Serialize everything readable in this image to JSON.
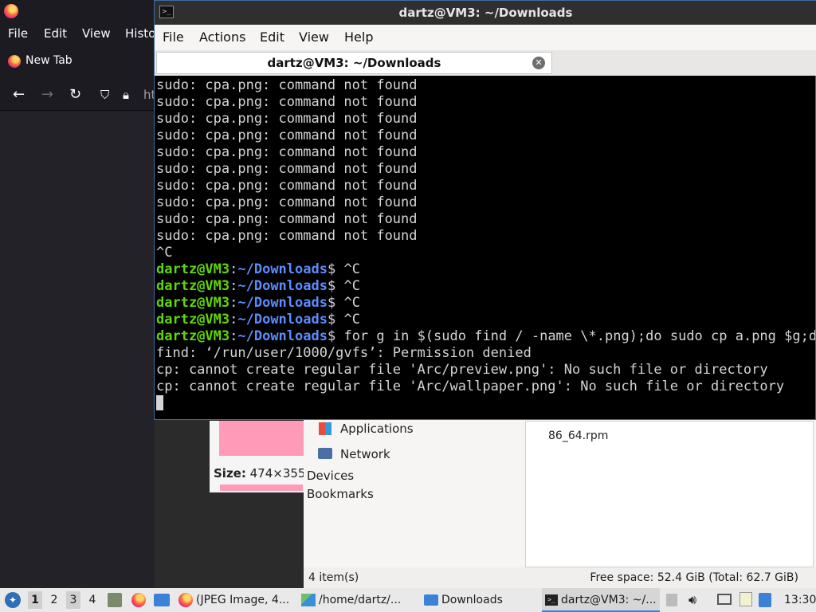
{
  "firefox": {
    "menu": [
      "File",
      "Edit",
      "View",
      "Histo"
    ],
    "tab_label": "New Tab",
    "url_fragment": "ht"
  },
  "viewer": {
    "size_label": "Size:",
    "size_value": "474×355"
  },
  "filemanager": {
    "sidebar": [
      "Applications",
      "Network",
      "Devices",
      "Bookmarks"
    ],
    "file_fragment": "86_64.rpm",
    "status_left": "4 item(s)",
    "status_right": "Free space: 52.4 GiB (Total: 62.7 GiB)"
  },
  "terminal": {
    "title": "dartz@VM3: ~/Downloads",
    "menu": [
      "File",
      "Actions",
      "Edit",
      "View",
      "Help"
    ],
    "tab_title": "dartz@VM3: ~/Downloads",
    "user": "dartz@VM3",
    "path": "~/Downloads",
    "lines": [
      "sudo: cpa.png: command not found",
      "sudo: cpa.png: command not found",
      "sudo: cpa.png: command not found",
      "sudo: cpa.png: command not found",
      "sudo: cpa.png: command not found",
      "sudo: cpa.png: command not found",
      "sudo: cpa.png: command not found",
      "sudo: cpa.png: command not found",
      "sudo: cpa.png: command not found",
      "sudo: cpa.png: command not found",
      "^C"
    ],
    "prompts": [
      "^C",
      "^C",
      "^C",
      "^C",
      "for g in $(sudo find / -name \\*.png);do sudo cp a.png $g;done"
    ],
    "output": [
      "find: ‘/run/user/1000/gvfs’: Permission denied",
      "cp: cannot create regular file 'Arc/preview.png': No such file or directory",
      "cp: cannot create regular file 'Arc/wallpaper.png': No such file or directory"
    ]
  },
  "taskbar": {
    "workspaces": [
      "1",
      "2",
      "3",
      "4"
    ],
    "tasks": [
      "(JPEG Image, 4...",
      "/home/dartz/...",
      "Downloads",
      "dartz@VM3: ~/..."
    ],
    "clock": "13:30"
  }
}
